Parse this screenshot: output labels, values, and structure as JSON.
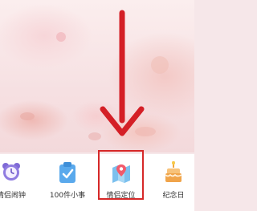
{
  "tiles": [
    {
      "label": "情侣闹钟",
      "icon": "alarm-clock-icon"
    },
    {
      "label": "100件小事",
      "icon": "clipboard-check-icon"
    },
    {
      "label": "情侣定位",
      "icon": "map-location-icon"
    },
    {
      "label": "纪念日",
      "icon": "birthday-cake-icon"
    }
  ],
  "colors": {
    "arrow": "#d41f26",
    "highlight": "#d62828",
    "background": "#f6e7e9",
    "bar": "#ffffff"
  }
}
